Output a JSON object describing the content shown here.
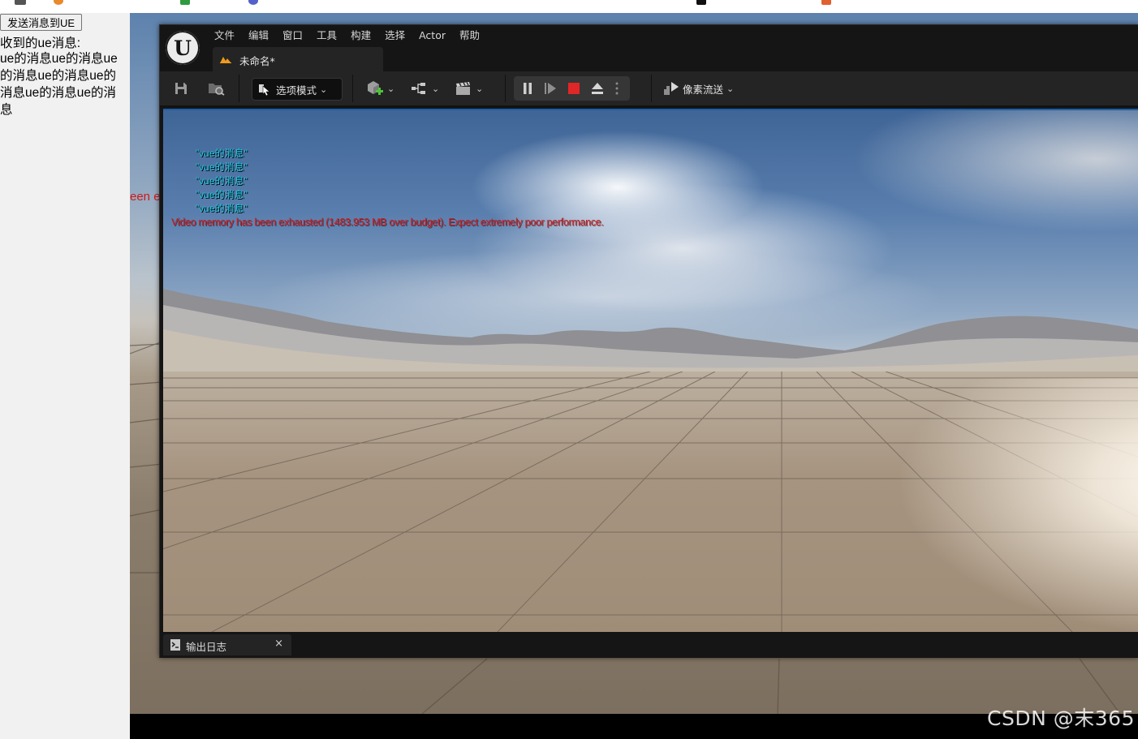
{
  "vue_panel": {
    "send_button": "发送消息到UE",
    "received_label": "收到的ue消息:",
    "received_text": "ue的消息ue的消息ue的消息ue的消息ue的消息ue的消息ue的消息"
  },
  "background": {
    "red_fragment": "een e"
  },
  "ue_editor": {
    "menu": [
      "文件",
      "编辑",
      "窗口",
      "工具",
      "构建",
      "选择",
      "Actor",
      "帮助"
    ],
    "doc_tab": "未命名*",
    "toolbar": {
      "select_mode": "选项模式",
      "pixel_streaming": "像素流送"
    },
    "viewport": {
      "vue_messages": [
        "\"vue的消息\"",
        "\"vue的消息\"",
        "\"vue的消息\"",
        "\"vue的消息\"",
        "\"vue的消息\""
      ],
      "memory_warning": "Video memory has been exhausted (1483.953 MB over budget). Expect extremely poor performance."
    },
    "output_log_tab": "输出日志",
    "close_symbol": "×"
  },
  "watermark": "CSDN @末365",
  "colors": {
    "ue_dark": "#151515",
    "ue_panel": "#242424",
    "viewport_border": "#1d5fa8",
    "vue_message": "#21c4dd",
    "warning_red": "#d8171a",
    "stop_red": "#e02626",
    "add_green": "#4fc43a",
    "level_orange": "#f09a1d"
  }
}
